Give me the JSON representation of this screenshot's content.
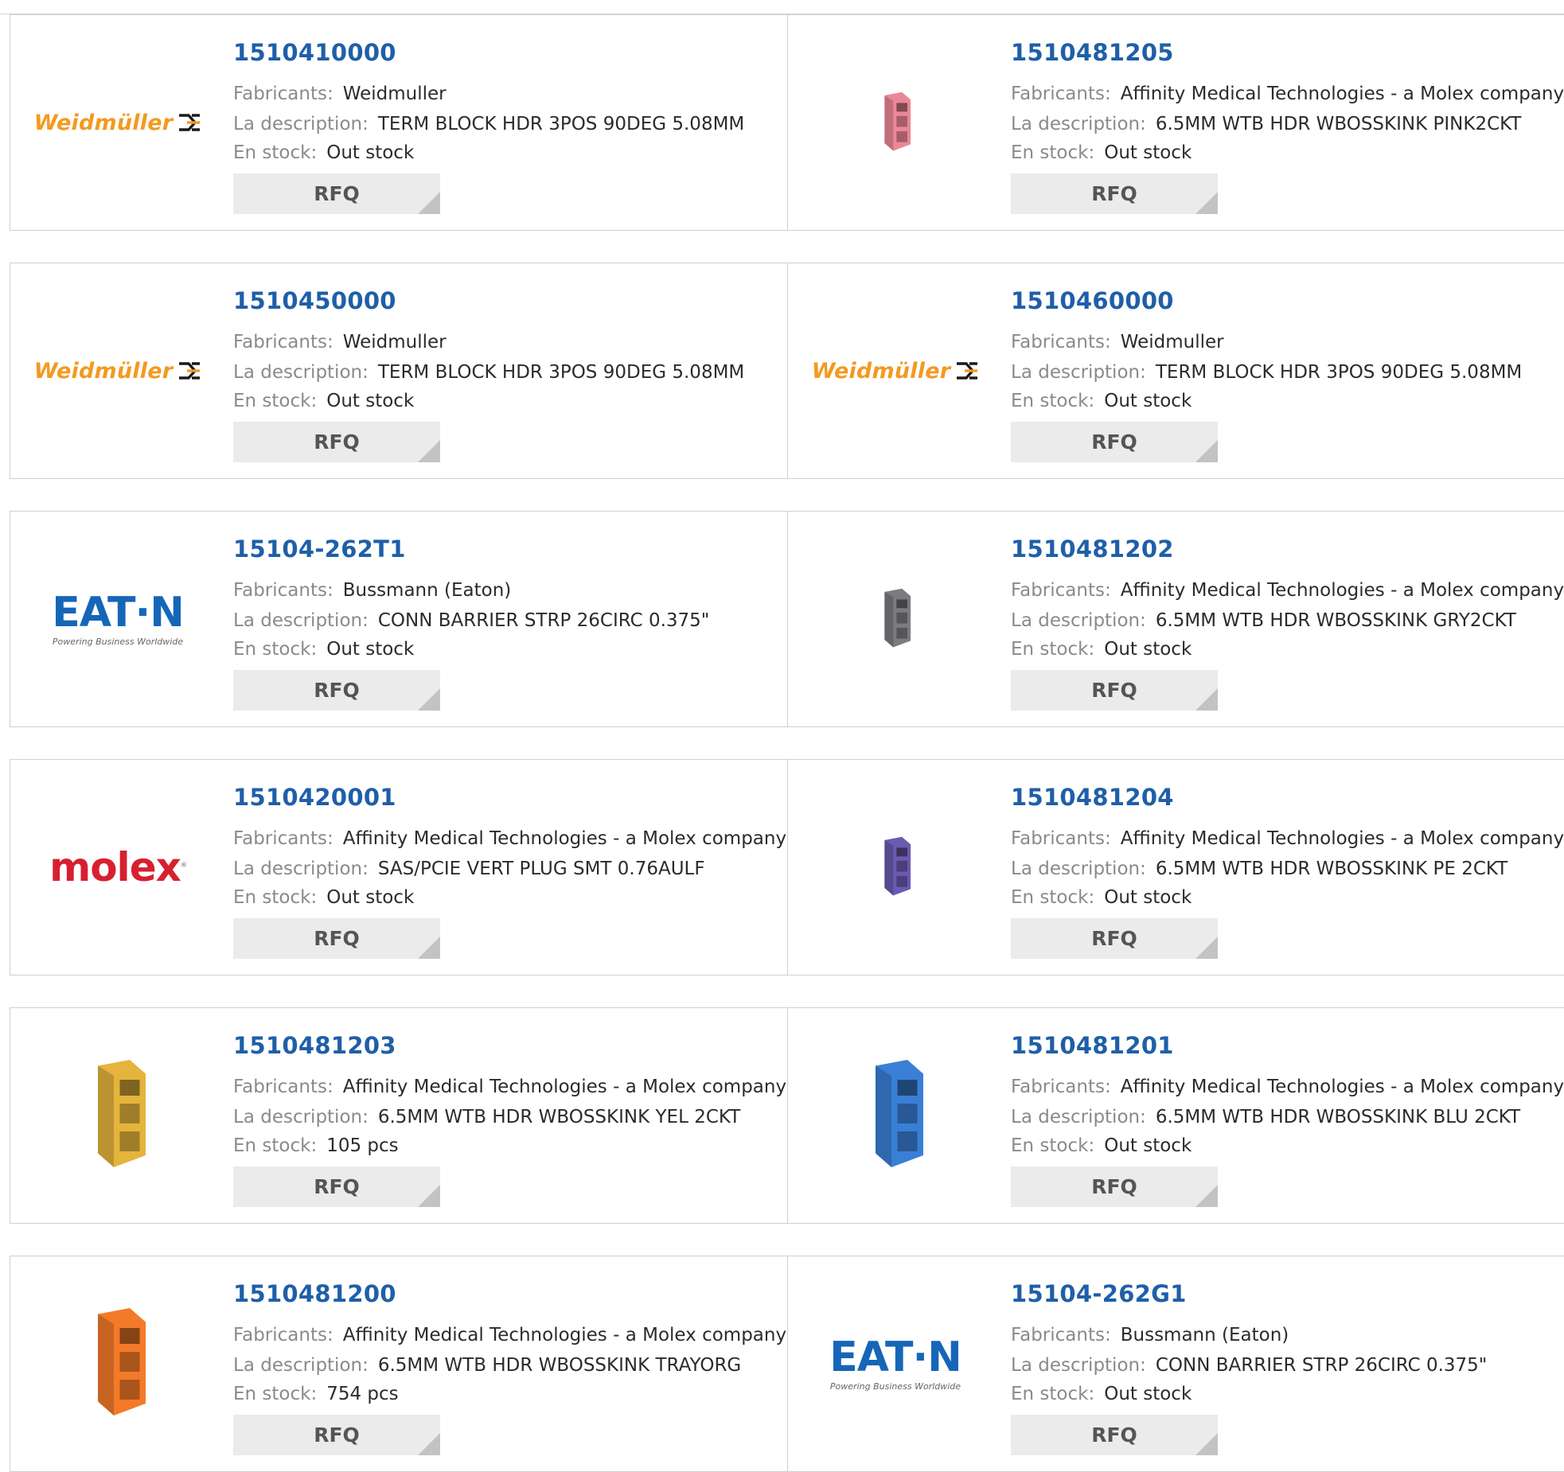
{
  "labels": {
    "manufacturer": "Fabricants:",
    "description": "La description:",
    "stock": "En stock:",
    "rfq": "RFQ"
  },
  "logos": {
    "weidmuller": "Weidmüller",
    "eaton": "EAT·N",
    "eaton_tagline": "Powering Business Worldwide",
    "molex": "molex"
  },
  "products": [
    {
      "part_number": "1510410000",
      "manufacturer": "Weidmuller",
      "description": "TERM BLOCK HDR 3POS 90DEG 5.08MM",
      "stock": "Out stock",
      "thumb": "weidmuller-logo"
    },
    {
      "part_number": "1510481205",
      "manufacturer": "Affinity Medical Technologies - a Molex company",
      "description": "6.5MM WTB HDR WBOSSKINK PINK2CKT",
      "stock": "Out stock",
      "thumb": "connector",
      "color": "#ec8797"
    },
    {
      "part_number": "1510450000",
      "manufacturer": "Weidmuller",
      "description": "TERM BLOCK HDR 3POS 90DEG 5.08MM",
      "stock": "Out stock",
      "thumb": "weidmuller-logo"
    },
    {
      "part_number": "1510460000",
      "manufacturer": "Weidmuller",
      "description": "TERM BLOCK HDR 3POS 90DEG 5.08MM",
      "stock": "Out stock",
      "thumb": "weidmuller-logo"
    },
    {
      "part_number": "15104-262T1",
      "manufacturer": "Bussmann (Eaton)",
      "description": "CONN BARRIER STRP 26CIRC 0.375\"",
      "stock": "Out stock",
      "thumb": "eaton-logo"
    },
    {
      "part_number": "1510481202",
      "manufacturer": "Affinity Medical Technologies - a Molex company",
      "description": "6.5MM WTB HDR WBOSSKINK GRY2CKT",
      "stock": "Out stock",
      "thumb": "connector",
      "color": "#7c7c80"
    },
    {
      "part_number": "1510420001",
      "manufacturer": "Affinity Medical Technologies - a Molex company",
      "description": "SAS/PCIE VERT PLUG SMT 0.76AULF",
      "stock": "Out stock",
      "thumb": "molex-logo"
    },
    {
      "part_number": "1510481204",
      "manufacturer": "Affinity Medical Technologies - a Molex company",
      "description": "6.5MM WTB HDR WBOSSKINK PE 2CKT",
      "stock": "Out stock",
      "thumb": "connector",
      "color": "#6a5ab0"
    },
    {
      "part_number": "1510481203",
      "manufacturer": "Affinity Medical Technologies - a Molex company",
      "description": "6.5MM WTB HDR WBOSSKINK YEL 2CKT",
      "stock": "105 pcs",
      "thumb": "connector",
      "color": "#e5b43c"
    },
    {
      "part_number": "1510481201",
      "manufacturer": "Affinity Medical Technologies - a Molex company",
      "description": "6.5MM WTB HDR WBOSSKINK BLU 2CKT",
      "stock": "Out stock",
      "thumb": "connector",
      "color": "#3a7fd6"
    },
    {
      "part_number": "1510481200",
      "manufacturer": "Affinity Medical Technologies - a Molex company",
      "description": "6.5MM WTB HDR WBOSSKINK TRAYORG",
      "stock": "754 pcs",
      "thumb": "connector",
      "color": "#f37a29"
    },
    {
      "part_number": "15104-262G1",
      "manufacturer": "Bussmann (Eaton)",
      "description": "CONN BARRIER STRP 26CIRC 0.375\"",
      "stock": "Out stock",
      "thumb": "eaton-logo"
    }
  ]
}
